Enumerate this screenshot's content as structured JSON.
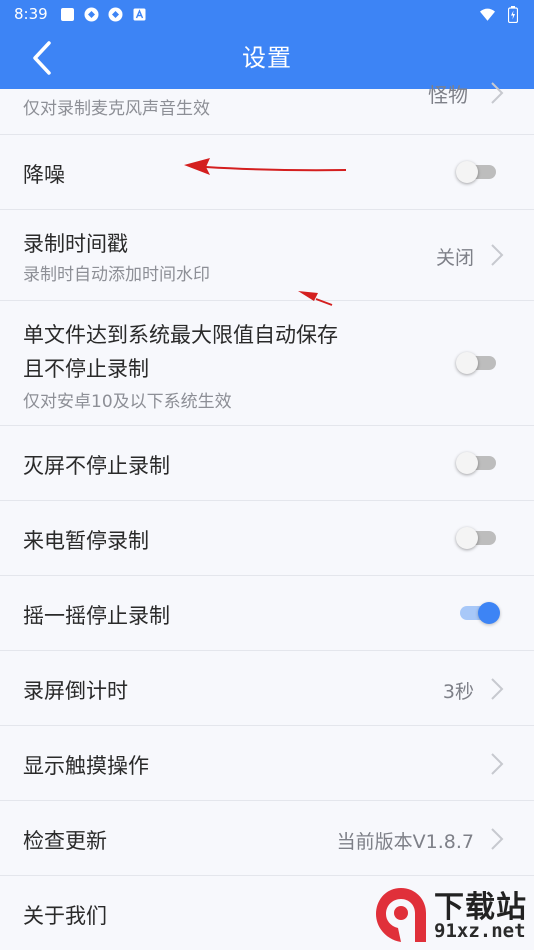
{
  "status_bar": {
    "time": "8:39",
    "notification_icons": [
      "square-icon",
      "sync-icon",
      "sync-icon",
      "a-icon"
    ],
    "system_icons": [
      "wifi-icon",
      "battery-icon"
    ]
  },
  "app_bar": {
    "title": "设置",
    "color": "#3d84f5",
    "back_icon": "back-arrow-icon"
  },
  "settings": {
    "partial_top": {
      "subtitle": "仅对录制麦克风声音生效",
      "value": "怪物"
    },
    "noise_reduction": {
      "title": "降噪",
      "toggle_on": false
    },
    "record_timestamp": {
      "title": "录制时间戳",
      "subtitle": "录制时自动添加时间水印",
      "value": "关闭"
    },
    "auto_save": {
      "title_line1": "单文件达到系统最大限值自动保存",
      "title_line2": "且不停止录制",
      "subtitle": "仅对安卓10及以下系统生效",
      "toggle_on": false
    },
    "screen_off": {
      "title": "灭屏不停止录制",
      "toggle_on": false
    },
    "incoming_call": {
      "title": "来电暂停录制",
      "toggle_on": false
    },
    "shake_stop": {
      "title": "摇一摇停止录制",
      "toggle_on": true
    },
    "countdown": {
      "title": "录屏倒计时",
      "value": "3秒"
    },
    "show_touch": {
      "title": "显示触摸操作"
    },
    "check_update": {
      "title": "检查更新",
      "value": "当前版本V1.8.7"
    },
    "about": {
      "title": "关于我们"
    }
  },
  "annotation_color": "#d41f1f",
  "watermark": {
    "line1": "下载站",
    "line2": "91xz.net",
    "logo_text": "9f"
  }
}
